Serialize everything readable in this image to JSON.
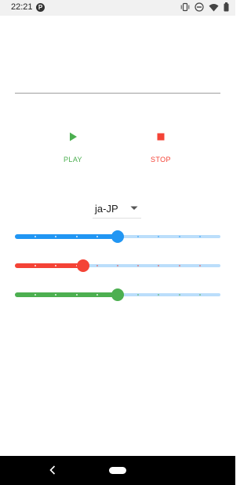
{
  "status_bar": {
    "time": "22:21",
    "app_badge": "P",
    "icons": [
      "vibrate-icon",
      "dnd-icon",
      "wifi-icon",
      "battery-icon"
    ]
  },
  "text_field": {
    "value": "",
    "placeholder": ""
  },
  "controls": {
    "play_label": "PLAY",
    "stop_label": "STOP",
    "play_color": "#4caf50",
    "stop_color": "#f44336"
  },
  "language": {
    "selected": "ja-JP"
  },
  "sliders": [
    {
      "name": "blue-slider",
      "color": "#2196f3",
      "track_color": "#bbdefb",
      "value": 0.5
    },
    {
      "name": "red-slider",
      "color": "#f44336",
      "track_color": "#bbdefb",
      "value": 0.333
    },
    {
      "name": "green-slider",
      "color": "#4caf50",
      "track_color": "#bbdefb",
      "value": 0.5
    }
  ],
  "nav_bar": {
    "icons": [
      "back-icon",
      "home-pill"
    ]
  }
}
